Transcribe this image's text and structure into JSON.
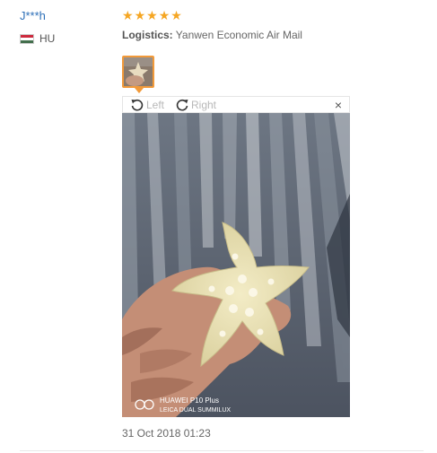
{
  "review": {
    "user": "J***h",
    "country": "HU",
    "rating": 5,
    "logistics_label": "Logistics:",
    "logistics_value": "Yanwen Economic Air Mail",
    "date": "31 Oct 2018 01:23"
  },
  "viewer": {
    "rotate_left_label": "Left",
    "rotate_right_label": "Right",
    "close_glyph": "×",
    "watermark_line1": "HUAWEI P10 Plus",
    "watermark_line2": "LEICA DUAL SUMMILUX"
  },
  "colors": {
    "accent": "#f29a3a",
    "star": "#f5a623",
    "user_link": "#2d6fb8"
  },
  "icons": [
    "flag-hu-icon",
    "star-icon",
    "rotate-left-icon",
    "rotate-right-icon",
    "close-icon"
  ]
}
